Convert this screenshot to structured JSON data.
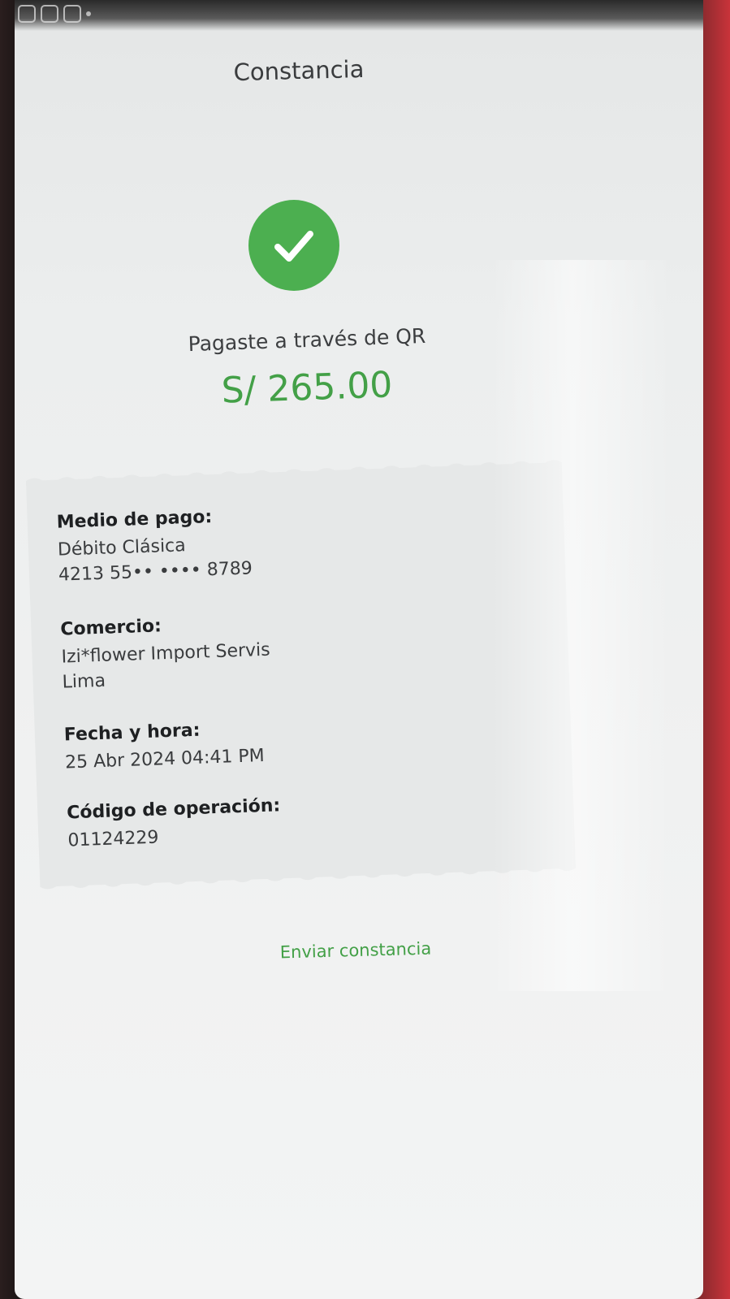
{
  "header": {
    "title": "Constancia"
  },
  "result": {
    "message": "Pagaste a través de QR",
    "amount": "S/ 265.00",
    "status_color": "#4caf50",
    "icon": "checkmark-icon"
  },
  "details": {
    "payment_method": {
      "label": "Medio de pago:",
      "card_type": "Débito Clásica",
      "card_number": "4213 55•• •••• 8789"
    },
    "merchant": {
      "label": "Comercio:",
      "name": "Izi*flower Import Servis",
      "city": "Lima"
    },
    "datetime": {
      "label": "Fecha y hora:",
      "value": "25 Abr 2024  04:41 PM"
    },
    "operation_code": {
      "label": "Código de operación:",
      "value": "01124229"
    }
  },
  "actions": {
    "send_label": "Enviar constancia"
  },
  "colors": {
    "accent": "#43a047",
    "background": "#eceeee",
    "receipt_bg": "#e6e8e8"
  }
}
